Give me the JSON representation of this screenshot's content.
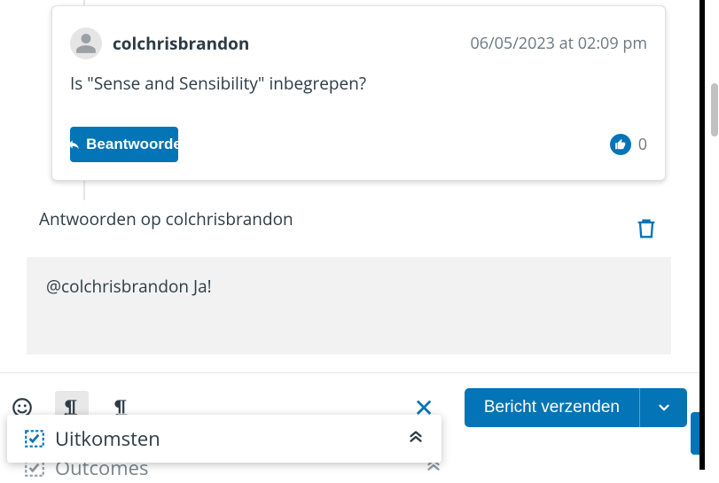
{
  "comment": {
    "author": "colchrisbrandon",
    "timestamp": "06/05/2023 at 02:09 pm",
    "body": "Is \"Sense and Sensibility\" inbegrepen?",
    "reply_button": "Beantwoorde",
    "like_count": "0"
  },
  "reply": {
    "heading": "Antwoorden op colchrisbrandon",
    "draft_text": "@colchrisbrandon Ja!"
  },
  "compose": {
    "close_glyph": "✕",
    "send_label": "Bericht verzenden"
  },
  "outcomes": {
    "label_front": "Uitkomsten",
    "label_ghost": "Outcomes"
  },
  "colors": {
    "primary": "#0374b5"
  }
}
